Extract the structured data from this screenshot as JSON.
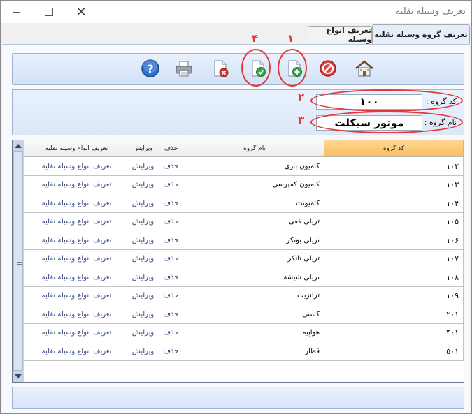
{
  "window": {
    "title": "تعریف وسیله نقلیه"
  },
  "tabs": [
    {
      "label": "تعریف گروه وسیله نقلیه",
      "active": true
    },
    {
      "label": "تعریف انواع وسیله",
      "active": false
    }
  ],
  "toolbar": {
    "buttons": [
      {
        "name": "home",
        "icon": "home-icon"
      },
      {
        "name": "cancel",
        "icon": "no-entry-icon"
      },
      {
        "name": "new",
        "icon": "new-document-icon",
        "marker": "۱"
      },
      {
        "name": "save",
        "icon": "save-document-icon",
        "marker": "۴"
      },
      {
        "name": "delete",
        "icon": "delete-document-icon"
      },
      {
        "name": "print",
        "icon": "printer-icon"
      },
      {
        "name": "help",
        "icon": "help-icon"
      }
    ]
  },
  "form": {
    "code_label": "کد گروه :",
    "code_value": "۱۰۰",
    "name_label": "نام گروه :",
    "name_value": "موتور سیکلت",
    "code_marker": "۲",
    "name_marker": "۳"
  },
  "grid": {
    "columns": [
      "کد گروه",
      "نام گروه",
      "حذف",
      "ویرایش",
      "تعریف انواع وسیله نقلیه"
    ],
    "rows": [
      {
        "code": "۱۰۲",
        "name": "کامیون باری",
        "delete": "حذف",
        "edit": "ویرایش",
        "define": "تعریف انواع وسیله نقلیه"
      },
      {
        "code": "۱۰۳",
        "name": "کامیون کمپرسی",
        "delete": "حذف",
        "edit": "ویرایش",
        "define": "تعریف انواع وسیله نقلیه"
      },
      {
        "code": "۱۰۴",
        "name": "کامیونت",
        "delete": "حذف",
        "edit": "ویرایش",
        "define": "تعریف انواع وسیله نقلیه"
      },
      {
        "code": "۱۰۵",
        "name": "تریلی کفی",
        "delete": "حذف",
        "edit": "ویرایش",
        "define": "تعریف انواع وسیله نقلیه"
      },
      {
        "code": "۱۰۶",
        "name": "تریلی بونکر",
        "delete": "حذف",
        "edit": "ویرایش",
        "define": "تعریف انواع وسیله نقلیه"
      },
      {
        "code": "۱۰۷",
        "name": "تریلی تانکر",
        "delete": "حذف",
        "edit": "ویرایش",
        "define": "تعریف انواع وسیله نقلیه"
      },
      {
        "code": "۱۰۸",
        "name": "تریلی شیشه",
        "delete": "حذف",
        "edit": "ویرایش",
        "define": "تعریف انواع وسیله نقلیه"
      },
      {
        "code": "۱۰۹",
        "name": "ترانزیت",
        "delete": "حذف",
        "edit": "ویرایش",
        "define": "تعریف انواع وسیله نقلیه"
      },
      {
        "code": "۲۰۱",
        "name": "کشتی",
        "delete": "حذف",
        "edit": "ویرایش",
        "define": "تعریف انواع وسیله نقلیه"
      },
      {
        "code": "۴۰۱",
        "name": "هواپیما",
        "delete": "حذف",
        "edit": "ویرایش",
        "define": "تعریف انواع وسیله نقلیه"
      },
      {
        "code": "۵۰۱",
        "name": "قطار",
        "delete": "حذف",
        "edit": "ویرایش",
        "define": "تعریف انواع وسیله نقلیه"
      }
    ]
  },
  "colors": {
    "annotation": "#e03a3a",
    "selected_header": "#f7be5c",
    "link": "#2a3f78"
  }
}
